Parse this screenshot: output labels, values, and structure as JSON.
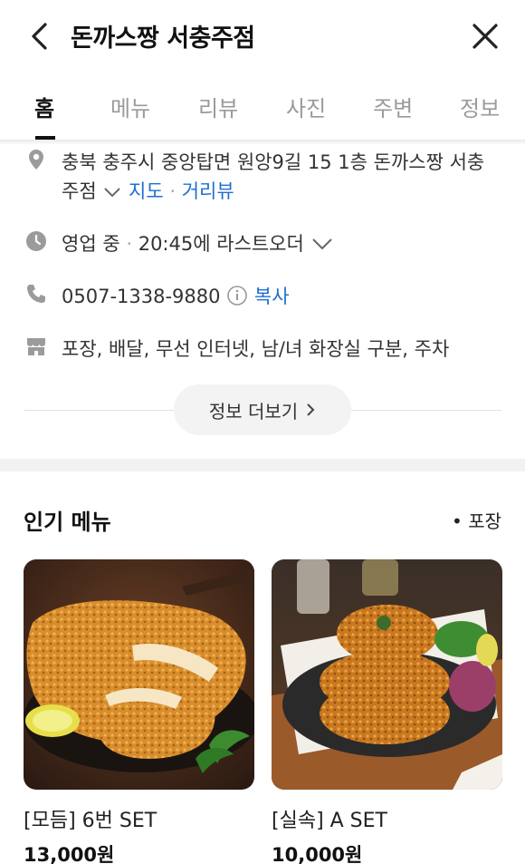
{
  "header": {
    "title": "돈까스짱 서충주점"
  },
  "tabs": [
    {
      "label": "홈"
    },
    {
      "label": "메뉴"
    },
    {
      "label": "리뷰"
    },
    {
      "label": "사진"
    },
    {
      "label": "주변"
    },
    {
      "label": "정보"
    }
  ],
  "info": {
    "address_line1": "충북 충주시 중앙탑면 원앙9길 15 1층 돈까스짱 서충",
    "address_line2": "주점",
    "map_link": "지도",
    "roadview_link": "거리뷰",
    "status": "영업 중",
    "last_order": "20:45에 라스트오더",
    "phone": "0507-1338-9880",
    "copy_link": "복사",
    "amenities": "포장, 배달, 무선 인터넷, 남/녀 화장실 구분, 주차",
    "more_button": "정보 더보기"
  },
  "popular": {
    "title": "인기 메뉴",
    "takeout_label": "포장",
    "items": [
      {
        "name": "[모듬] 6번 SET",
        "price": "13,000원"
      },
      {
        "name": "[실속] A SET",
        "price": "10,000원"
      }
    ]
  },
  "colors": {
    "link": "#1f6fd1",
    "section_gap": "#f2f2f2",
    "tab_inactive": "#9a9a9a"
  }
}
